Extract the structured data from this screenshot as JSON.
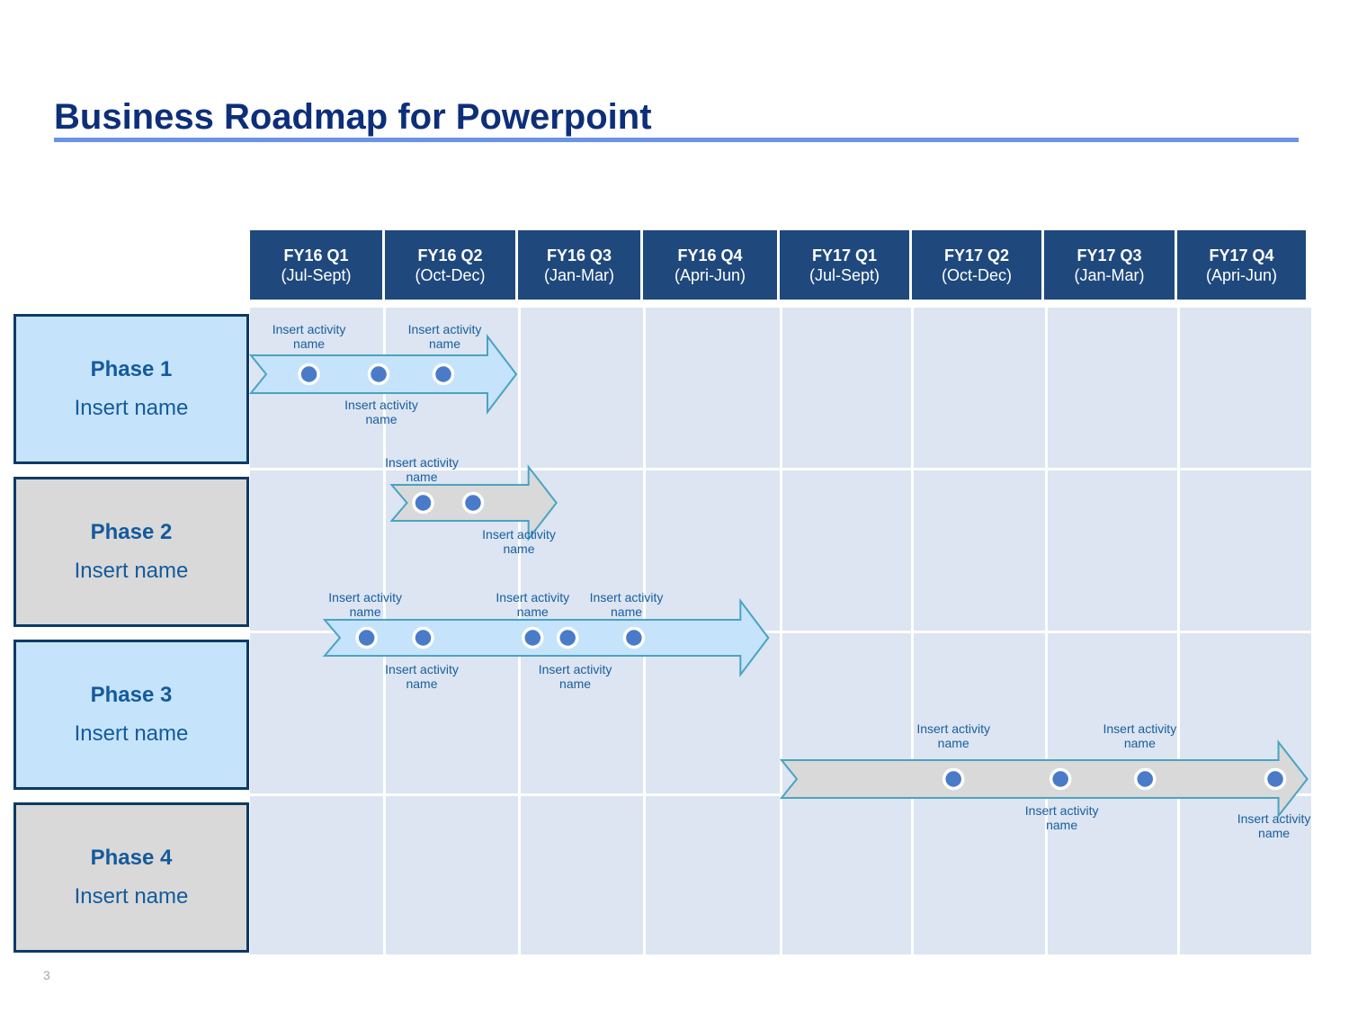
{
  "title": "Business Roadmap for Powerpoint",
  "page_number": "3",
  "colors": {
    "title": "#0d2f7a",
    "title_rule": "#6b93e6",
    "header_bg": "#1f497d",
    "grid_bg": "#dce5f1",
    "phase_blue": "#c5e3fb",
    "phase_grey": "#d9d9d9",
    "phase_border": "#0e3a66",
    "arrow_stroke": "#4aa3c2",
    "milestone": "#4a7bc8",
    "label_text": "#1a5ea0"
  },
  "quarters": [
    {
      "q": "FY16 Q1",
      "range": "(Jul-Sept)"
    },
    {
      "q": "FY16 Q2",
      "range": "(Oct-Dec)"
    },
    {
      "q": "FY16 Q3",
      "range": "(Jan-Mar)"
    },
    {
      "q": "FY16 Q4",
      "range": "(Apri-Jun)"
    },
    {
      "q": "FY17 Q1",
      "range": "(Jul-Sept)"
    },
    {
      "q": "FY17 Q2",
      "range": "(Oct-Dec)"
    },
    {
      "q": "FY17 Q3",
      "range": "(Jan-Mar)"
    },
    {
      "q": "FY17 Q4",
      "range": "(Apri-Jun)"
    }
  ],
  "phases": [
    {
      "title": "Phase 1",
      "name": "Insert name",
      "style": "blue"
    },
    {
      "title": "Phase 2",
      "name": "Insert name",
      "style": "grey"
    },
    {
      "title": "Phase 3",
      "name": "Insert name",
      "style": "blue"
    },
    {
      "title": "Phase 4",
      "name": "Insert name",
      "style": "grey"
    }
  ],
  "activities": [
    {
      "phase": "Phase 1",
      "fill": "blue",
      "start_quarter": 1.0,
      "end_quarter": 2.98,
      "milestones": [
        1.44,
        1.96,
        2.44
      ],
      "labels": [
        {
          "text": "Insert activity name",
          "pos": "above",
          "at": 1.44
        },
        {
          "text": "Insert activity name",
          "pos": "above",
          "at": 2.45
        },
        {
          "text": "Insert activity name",
          "pos": "below",
          "at": 1.98
        }
      ]
    },
    {
      "phase": "Phase 2",
      "fill": "grey",
      "start_quarter": 2.05,
      "end_quarter": 3.3,
      "milestones": [
        2.29,
        2.66
      ],
      "labels": [
        {
          "text": "Insert activity name",
          "pos": "above",
          "at": 2.28
        },
        {
          "text": "Insert activity name",
          "pos": "below",
          "at": 3.0
        }
      ]
    },
    {
      "phase": "Phase 3",
      "fill": "blue",
      "start_quarter": 1.55,
      "end_quarter": 4.91,
      "milestones": [
        1.87,
        2.29,
        3.11,
        3.39,
        3.92
      ],
      "labels": [
        {
          "text": "Insert activity name",
          "pos": "above",
          "at": 1.86
        },
        {
          "text": "Insert activity name",
          "pos": "above",
          "at": 3.11
        },
        {
          "text": "Insert activity name",
          "pos": "above",
          "at": 3.86
        },
        {
          "text": "Insert activity name",
          "pos": "below",
          "at": 2.28
        },
        {
          "text": "Insert activity name",
          "pos": "below",
          "at": 3.45
        }
      ]
    },
    {
      "phase": "Phase 4",
      "fill": "grey",
      "start_quarter": 5.0,
      "end_quarter": 8.97,
      "milestones": [
        6.31,
        7.11,
        7.75,
        8.73
      ],
      "labels": [
        {
          "text": "Insert activity name",
          "pos": "above",
          "at": 6.31
        },
        {
          "text": "Insert activity name",
          "pos": "above",
          "at": 7.71
        },
        {
          "text": "Insert activity name",
          "pos": "below",
          "at": 7.12
        },
        {
          "text": "Insert activity name",
          "pos": "below",
          "at": 8.72
        }
      ]
    }
  ]
}
